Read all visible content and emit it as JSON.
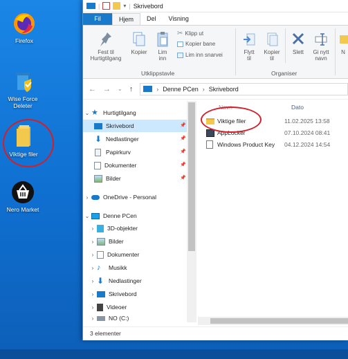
{
  "desktop": {
    "icons": [
      {
        "label": "Firefox"
      },
      {
        "label": "Wise Force Deleter"
      },
      {
        "label": "Viktige filer"
      },
      {
        "label": "Nero Market"
      }
    ]
  },
  "window": {
    "title": "Skrivebord",
    "tabs": [
      "Fil",
      "Hjem",
      "Del",
      "Visning"
    ],
    "ribbon": {
      "pin_label": "Fest til Hurtigtilgang",
      "copy_label": "Kopier",
      "paste_label": "Lim inn",
      "cut_label": "Klipp ut",
      "copy_path_label": "Kopier bane",
      "paste_shortcut_label": "Lim inn snarvei",
      "clipboard_group": "Utklippstavle",
      "move_label": "Flytt til",
      "copyto_label": "Kopier til",
      "delete_label": "Slett",
      "rename_label": "Gi nytt navn",
      "organize_group": "Organiser",
      "new_label": "N"
    },
    "address": {
      "crumbs": [
        "Denne PCen",
        "Skrivebord"
      ]
    },
    "nav": {
      "quick_access": "Hurtigtilgang",
      "quick_items": [
        "Skrivebord",
        "Nedlastinger",
        "Papirkurv",
        "Dokumenter",
        "Bilder"
      ],
      "onedrive": "OneDrive - Personal",
      "this_pc": "Denne PCen",
      "pc_items": [
        "3D-objekter",
        "Bilder",
        "Dokumenter",
        "Musikk",
        "Nedlastinger",
        "Skrivebord",
        "Videoer",
        "NO (C:)"
      ]
    },
    "columns": {
      "name": "Navn",
      "date": "Dato"
    },
    "files": [
      {
        "name": "Viktige filer",
        "date": "11.02.2025 13:58"
      },
      {
        "name": "AppLocker",
        "date": "07.10.2024 08:41"
      },
      {
        "name": "Windows Product Key",
        "date": "04.12.2024 14:54"
      }
    ],
    "status": "3 elementer"
  },
  "colors": {
    "accent": "#1979ca",
    "selection": "#cce8ff",
    "annotation": "#d21f2a",
    "desktop": "#1a86e6"
  }
}
